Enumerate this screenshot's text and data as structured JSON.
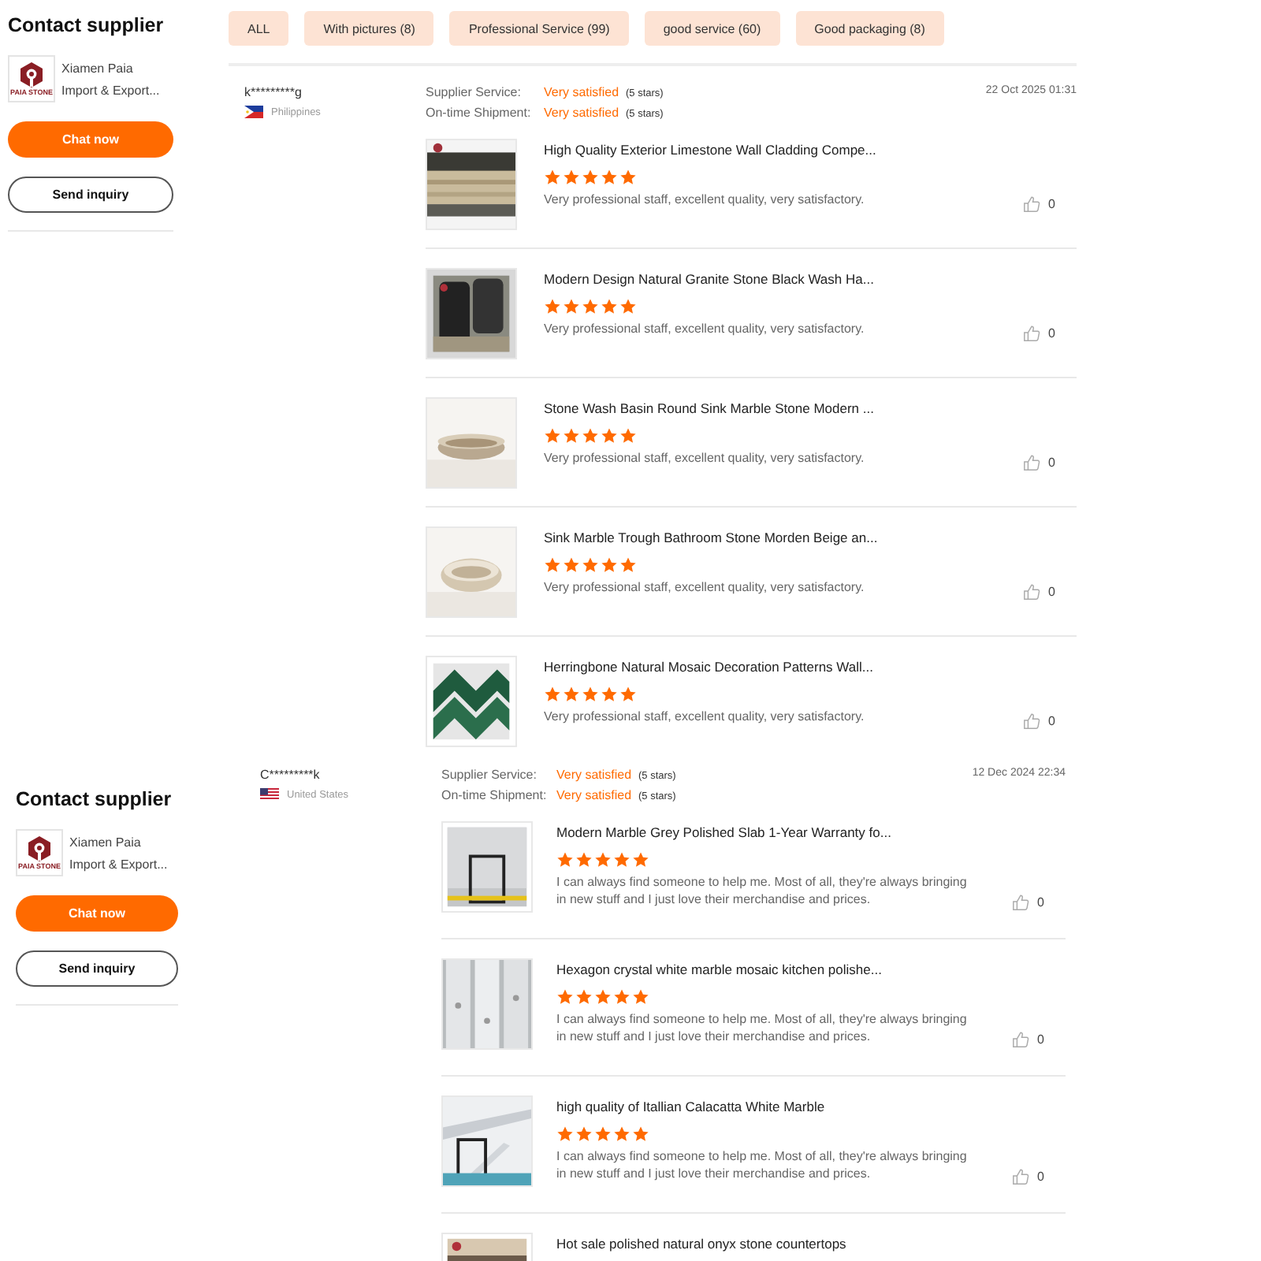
{
  "sections": [
    {
      "sidebar": {
        "title": "Contact supplier",
        "company": [
          "Xiamen Paia",
          "Import & Export..."
        ],
        "logo_caption": "PAIA STONE",
        "chat": "Chat now",
        "inquiry": "Send inquiry"
      },
      "filters": [
        "ALL",
        "With pictures (8)",
        "Professional Service (99)",
        "good service (60)",
        "Good packaging (8)"
      ],
      "review": {
        "reviewer": "k*********g",
        "country": "Philippines",
        "date": "22 Oct 2025 01:31",
        "ratings": [
          {
            "label": "Supplier Service:",
            "value": "Very satisfied",
            "note": "(5 stars)"
          },
          {
            "label": "On-time Shipment:",
            "value": "Very satisfied",
            "note": "(5 stars)"
          }
        ],
        "items": [
          {
            "title": "High Quality Exterior Limestone Wall Cladding Compe...",
            "stars": 5,
            "text": "Very professional staff, excellent quality, very satisfactory.",
            "likes": "0"
          },
          {
            "title": "Modern Design Natural Granite Stone Black Wash Ha...",
            "stars": 5,
            "text": "Very professional staff, excellent quality, very satisfactory.",
            "likes": "0"
          },
          {
            "title": "Stone Wash Basin Round Sink Marble Stone Modern ...",
            "stars": 5,
            "text": "Very professional staff, excellent quality, very satisfactory.",
            "likes": "0"
          },
          {
            "title": "Sink Marble Trough Bathroom Stone Morden Beige an...",
            "stars": 5,
            "text": "Very professional staff, excellent quality, very satisfactory.",
            "likes": "0"
          },
          {
            "title": "Herringbone Natural Mosaic Decoration Patterns Wall...",
            "stars": 5,
            "text": "Very professional staff, excellent quality, very satisfactory.",
            "likes": "0"
          }
        ]
      }
    },
    {
      "sidebar": {
        "title": "Contact supplier",
        "company": [
          "Xiamen Paia",
          "Import & Export..."
        ],
        "logo_caption": "PAIA STONE",
        "chat": "Chat now",
        "inquiry": "Send inquiry"
      },
      "review": {
        "reviewer": "C*********k",
        "country": "United States",
        "date": "12 Dec 2024 22:34",
        "ratings": [
          {
            "label": "Supplier Service:",
            "value": "Very satisfied",
            "note": "(5 stars)"
          },
          {
            "label": "On-time Shipment:",
            "value": "Very satisfied",
            "note": "(5 stars)"
          }
        ],
        "items": [
          {
            "title": "Modern Marble Grey Polished Slab 1-Year Warranty fo...",
            "stars": 5,
            "text": "I can always find someone to help me. Most of all, they're always bringing in new stuff and I just love their merchandise and prices.",
            "likes": "0"
          },
          {
            "title": "Hexagon crystal white marble mosaic kitchen polishe...",
            "stars": 5,
            "text": "I can always find someone to help me. Most of all, they're always bringing in new stuff and I just love their merchandise and prices.",
            "likes": "0"
          },
          {
            "title": "high quality of Itallian Calacatta White Marble",
            "stars": 5,
            "text": "I can always find someone to help me. Most of all, they're always bringing in new stuff and I just love their merchandise and prices.",
            "likes": "0"
          },
          {
            "title": "Hot sale polished natural onyx stone countertops"
          }
        ]
      }
    }
  ]
}
